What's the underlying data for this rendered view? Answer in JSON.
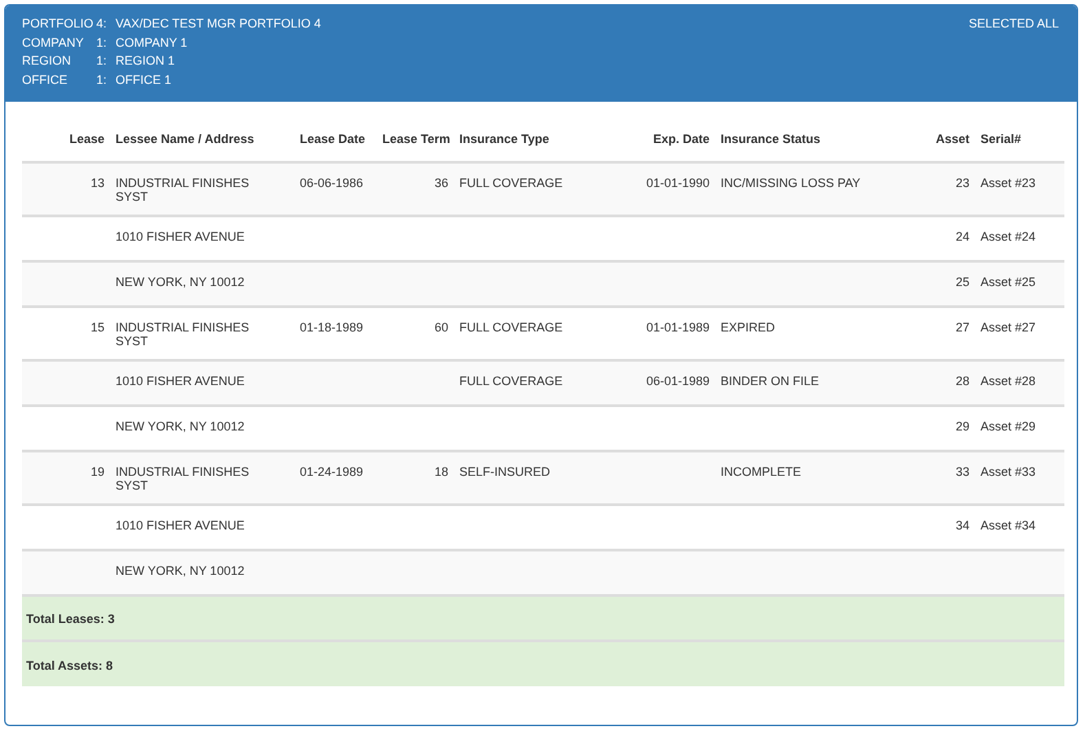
{
  "header": {
    "fields": [
      {
        "label": "PORTFOLIO",
        "number": "4:",
        "value": "VAX/DEC TEST MGR PORTFOLIO 4"
      },
      {
        "label": "COMPANY",
        "number": "1:",
        "value": "COMPANY 1"
      },
      {
        "label": "REGION",
        "number": "1:",
        "value": "REGION 1"
      },
      {
        "label": "OFFICE",
        "number": "1:",
        "value": "OFFICE 1"
      }
    ],
    "selection": "SELECTED ALL"
  },
  "table": {
    "columns": [
      "Lease",
      "Lessee Name / Address",
      "Lease Date",
      "Lease Term",
      "Insurance Type",
      "Exp. Date",
      "Insurance Status",
      "Asset",
      "Serial#"
    ],
    "rows": [
      {
        "lease": "13",
        "lessee": "INDUSTRIAL FINISHES SYST",
        "lease_date": "06-06-1986",
        "lease_term": "36",
        "insurance_type": "FULL COVERAGE",
        "exp_date": "01-01-1990",
        "insurance_status": "INC/MISSING LOSS PAY",
        "asset": "23",
        "serial": "Asset #23"
      },
      {
        "lessee": "1010 FISHER AVENUE",
        "asset": "24",
        "serial": "Asset #24"
      },
      {
        "lessee": "NEW YORK, NY 10012",
        "asset": "25",
        "serial": "Asset #25"
      },
      {
        "lease": "15",
        "lessee": "INDUSTRIAL FINISHES SYST",
        "lease_date": "01-18-1989",
        "lease_term": "60",
        "insurance_type": "FULL COVERAGE",
        "exp_date": "01-01-1989",
        "insurance_status": "EXPIRED",
        "asset": "27",
        "serial": "Asset #27"
      },
      {
        "lessee": "1010 FISHER AVENUE",
        "insurance_type": "FULL COVERAGE",
        "exp_date": "06-01-1989",
        "insurance_status": "BINDER ON FILE",
        "asset": "28",
        "serial": "Asset #28"
      },
      {
        "lessee": "NEW YORK, NY 10012",
        "asset": "29",
        "serial": "Asset #29"
      },
      {
        "lease": "19",
        "lessee": "INDUSTRIAL FINISHES SYST",
        "lease_date": "01-24-1989",
        "lease_term": "18",
        "insurance_type": "SELF-INSURED",
        "insurance_status": "INCOMPLETE",
        "asset": "33",
        "serial": "Asset #33"
      },
      {
        "lessee": "1010 FISHER AVENUE",
        "asset": "34",
        "serial": "Asset #34"
      },
      {
        "lessee": "NEW YORK, NY 10012"
      }
    ],
    "totals": [
      "Total Leases: 3",
      "Total Assets: 8"
    ]
  }
}
